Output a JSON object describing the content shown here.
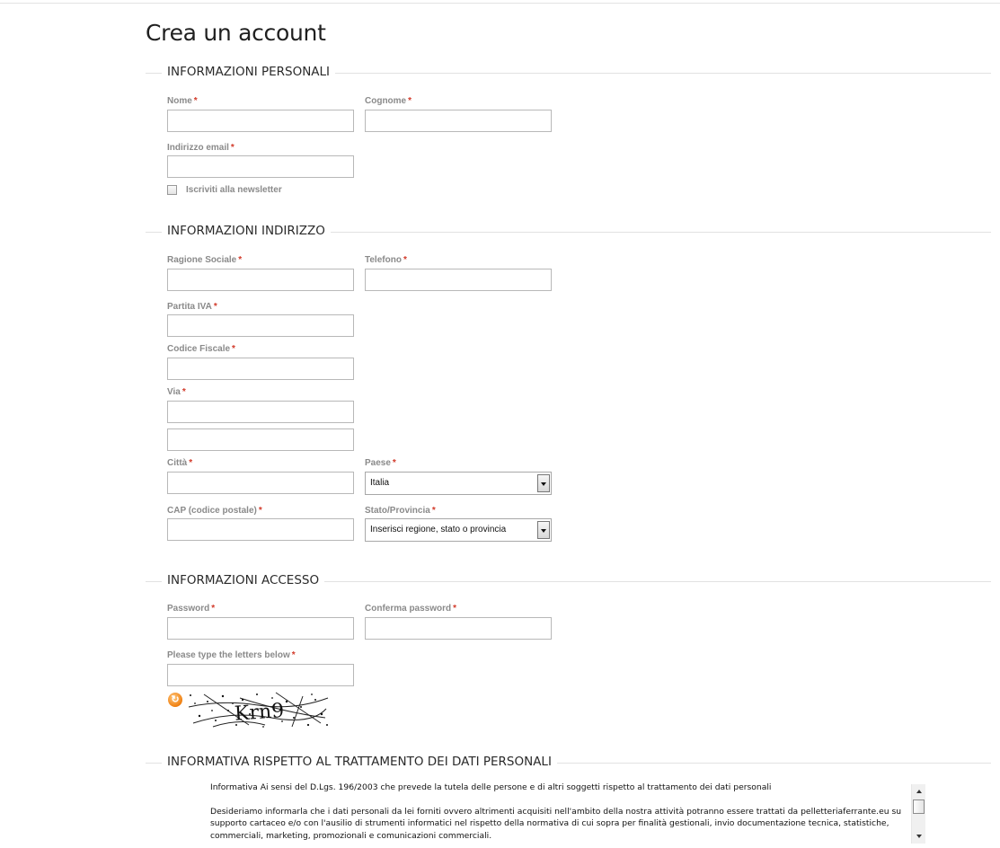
{
  "page": {
    "title": "Crea un account"
  },
  "personal": {
    "title": "INFORMAZIONI PERSONALI",
    "first_name_label": "Nome",
    "last_name_label": "Cognome",
    "email_label": "Indirizzo email",
    "newsletter_label": "Iscriviti alla newsletter",
    "newsletter_checked": false
  },
  "address": {
    "title": "INFORMAZIONI INDIRIZZO",
    "company_label": "Ragione Sociale",
    "phone_label": "Telefono",
    "vat_label": "Partita IVA",
    "tax_code_label": "Codice Fiscale",
    "street_label": "Via",
    "city_label": "Città",
    "country_label": "Paese",
    "country_value": "Italia",
    "zip_label": "CAP (codice postale)",
    "region_label": "Stato/Provincia",
    "region_value": "Inserisci regione, stato o provincia"
  },
  "access": {
    "title": "INFORMAZIONI ACCESSO",
    "password_label": "Password",
    "confirm_label": "Conferma password",
    "captcha_label": "Please type the letters below",
    "captcha_text": "Krn9"
  },
  "privacy": {
    "title": "INFORMATIVA RISPETTO AL TRATTAMENTO DEI DATI PERSONALI",
    "line1": "Informativa Ai sensi del D.Lgs. 196/2003 che prevede la tutela delle persone e di altri soggetti rispetto al trattamento dei dati personali",
    "line2": "Desideriamo informarla che i dati personali da lei forniti ovvero altrimenti acquisiti nell'ambito della nostra attività potranno essere trattati da pelletteriaferrante.eu su supporto cartaceo e/o con l'ausilio di strumenti informatici nel rispetto della normativa di cui sopra per finalità gestionali, invio documentazione tecnica, statistiche, commerciali, marketing, promozionali e comunicazioni commerciali."
  },
  "required_mark": "*",
  "colors": {
    "required": "#d23a2a",
    "label": "#8a8a8a",
    "border": "#b8b8b8",
    "refresh_icon": "#f08010"
  }
}
